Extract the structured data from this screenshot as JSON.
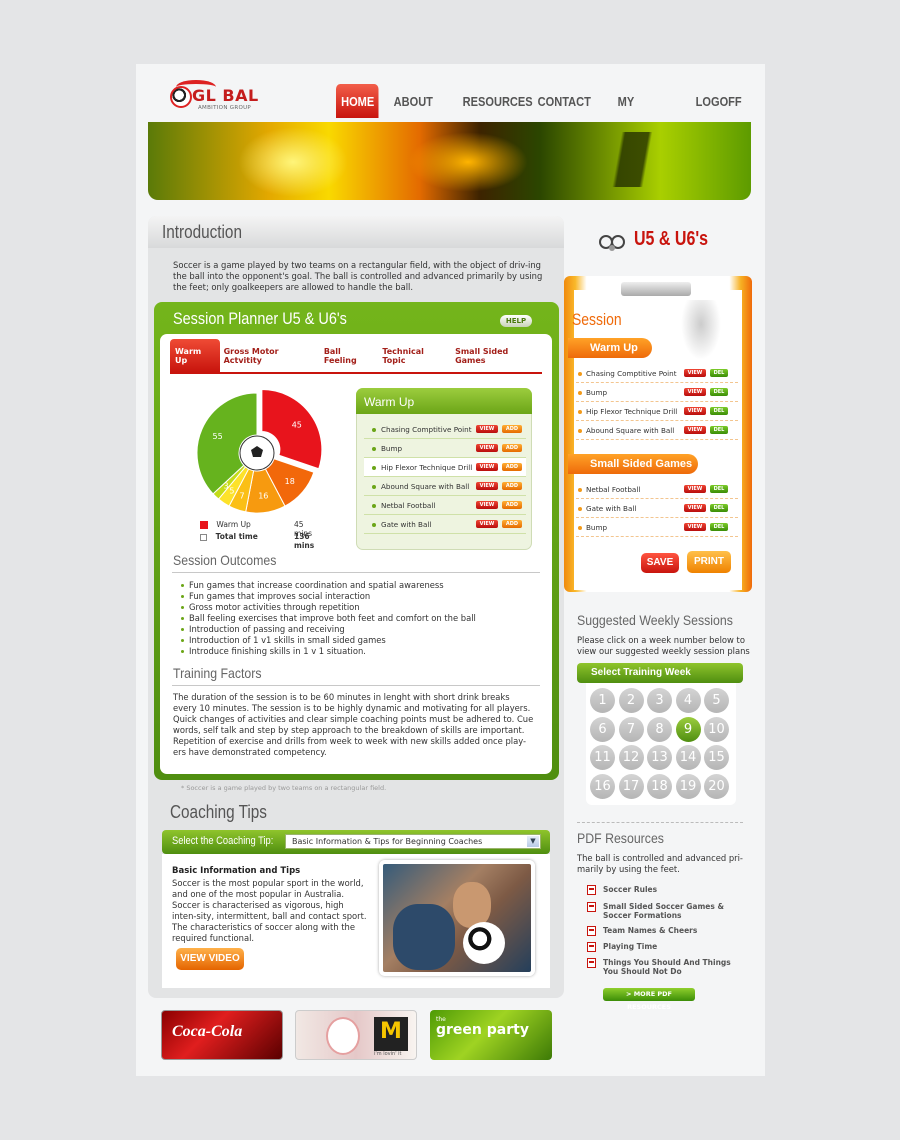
{
  "header": {
    "logo_main": "GL  BAL",
    "logo_sub": "AMBITION GROUP",
    "nav": [
      "HOME",
      "ABOUT US",
      "RESOURCES",
      "CONTACT US",
      "MY PROFILE",
      "LOGOFF"
    ]
  },
  "intro": {
    "title": "Introduction",
    "text": "Soccer is a game played by two teams on a rectangular field, with the object of driv-ing the ball into the opponent's goal. The ball is controlled and advanced primarily by using the feet; only goalkeepers are allowed to handle the ball."
  },
  "planner": {
    "title": "Session Planner U5 & U6's",
    "help": "HELP",
    "tabs": [
      "Warm Up",
      "Gross Motor Actvitity",
      "Ball Feeling",
      "Technical Topic",
      "Small Sided Games"
    ],
    "legend": {
      "label1": "Warm Up",
      "value1": "45 mins",
      "label2": "Total time",
      "value2": "136 mins"
    },
    "warmup_title": "Warm Up",
    "drills": [
      "Chasing Comptitive Point",
      "Bump",
      "Hip Flexor Technique Drill",
      "Abound Square with Ball",
      "Netbal Football",
      "Gate with Ball"
    ],
    "view": "VIEW",
    "add": "ADD",
    "outcomes_title": "Session Outcomes",
    "outcomes": [
      "Fun games that increase coordination and spatial awareness",
      "Fun games that improves social interaction",
      "Gross motor activities through repetition",
      "Ball feeling exercises that improve both feet and comfort on the ball",
      "Introduction of passing and receiving",
      "Introduction of 1 v1 skills in small sided games",
      "Introduce finishing skills in 1 v 1 situation."
    ],
    "factors_title": "Training Factors",
    "factors_text": "The duration of the session is to be 60 minutes in lenght with short drink breaks every 10 minutes. The session is to be highly dynamic and motivating for all players. Quick changes of activities and clear simple coaching points must be adhered to. Cue words, self talk and step by step approach to the breakdown of skills are important. Repetition of exercise and drills from week to week with new skills added once play-ers have demonstrated competency.",
    "footnote": "* Soccer is a game played by two teams on a rectangular field."
  },
  "chart_data": {
    "type": "pie",
    "values": [
      45,
      18,
      16,
      7,
      5,
      3,
      55
    ],
    "colors": [
      "#e8141c",
      "#f2680a",
      "#f79a0f",
      "#fbbf16",
      "#fde22a",
      "#c4dc18",
      "#66b31e"
    ],
    "labels_visible": [
      "45",
      "18",
      "16",
      "7",
      "5",
      "3",
      "55"
    ]
  },
  "tips": {
    "title": "Coaching Tips",
    "select_label": "Select the Coaching Tip:",
    "select_value": "Basic Information & Tips for Beginning Coaches",
    "head": "Basic Information and Tips",
    "text": "Soccer is the most popular sport in the world, and one of the most popular in Australia. Soccer is characterised as vigorous, high inten-sity, intermittent, ball and contact sport. The characteristics of soccer along with the required functional.",
    "video": "VIEW VIDEO"
  },
  "ads": {
    "coke": "Coca-Cola",
    "mcd": "i'm lovin' it",
    "green_small": "the",
    "green": "green party"
  },
  "session": {
    "age_title": "U5 & U6's",
    "title": "Session",
    "warmup_head": "Warm Up",
    "warmup_items": [
      "Chasing Comptitive Point",
      "Bump",
      "Hip Flexor Technique Drill",
      "Abound Square with Ball"
    ],
    "ssg_head": "Small Sided Games",
    "ssg_items": [
      "Netbal Football",
      "Gate with Ball",
      "Bump"
    ],
    "view": "VIEW",
    "del": "DEL",
    "save": "SAVE",
    "print": "PRINT"
  },
  "weekly": {
    "title": "Suggested Weekly Sessions",
    "text": "Please click on a week number below to view our suggested weekly session plans",
    "bar": "Select Training Week",
    "weeks": [
      "1",
      "2",
      "3",
      "4",
      "5",
      "6",
      "7",
      "8",
      "9",
      "10",
      "11",
      "12",
      "13",
      "14",
      "15",
      "16",
      "17",
      "18",
      "19",
      "20"
    ],
    "selected": "9"
  },
  "pdf": {
    "title": "PDF Resources",
    "text": "The ball is controlled and advanced pri-marily by using the feet.",
    "items": [
      "Soccer Rules",
      "Small Sided Soccer Games & Soccer Formations",
      "Team Names & Cheers",
      "Playing Time",
      "Things You Should And Things You Should Not Do"
    ],
    "more": "> MORE PDF RESOURCES"
  }
}
